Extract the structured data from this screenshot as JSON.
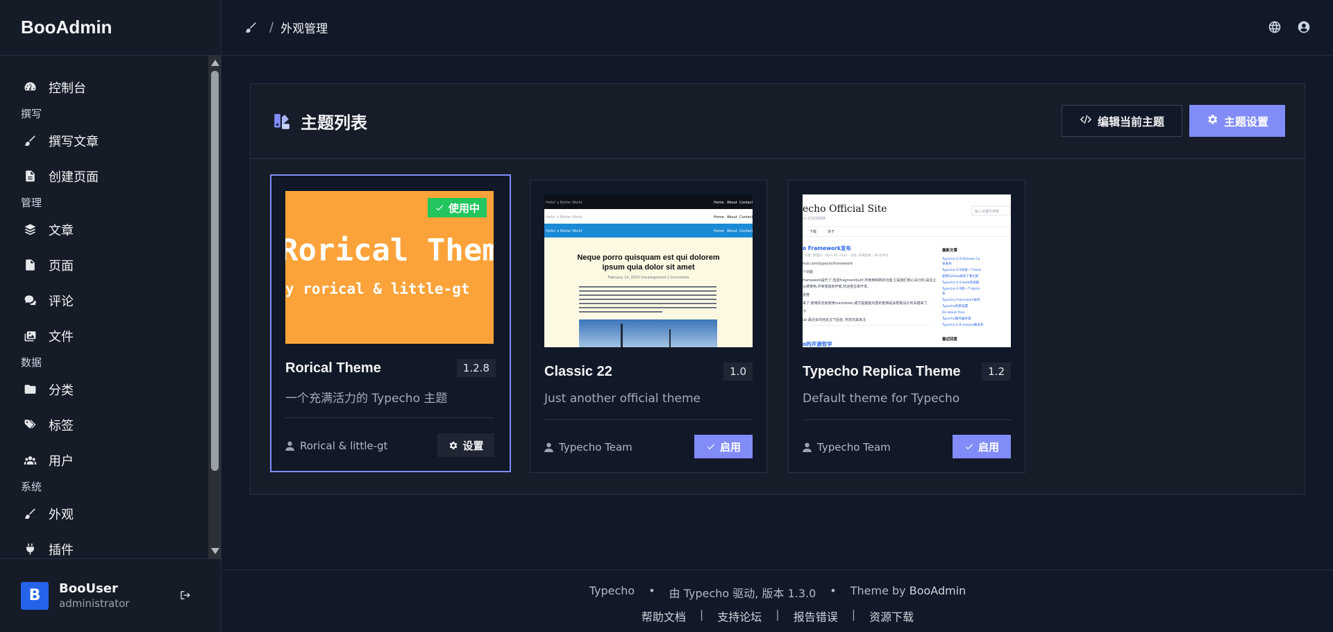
{
  "app": {
    "brand": "BooAdmin"
  },
  "sidebar": {
    "items": [
      {
        "label": "控制台",
        "icon": "dashboard-icon",
        "name": "sidebar-item-dashboard"
      },
      {
        "section": "撰写"
      },
      {
        "label": "撰写文章",
        "icon": "brush-icon",
        "name": "sidebar-item-write-post"
      },
      {
        "label": "创建页面",
        "icon": "file-text-icon",
        "name": "sidebar-item-create-page"
      },
      {
        "section": "管理"
      },
      {
        "label": "文章",
        "icon": "layers-icon",
        "name": "sidebar-item-posts"
      },
      {
        "label": "页面",
        "icon": "file-icon",
        "name": "sidebar-item-pages"
      },
      {
        "label": "评论",
        "icon": "comments-icon",
        "name": "sidebar-item-comments"
      },
      {
        "label": "文件",
        "icon": "images-icon",
        "name": "sidebar-item-files"
      },
      {
        "section": "数据"
      },
      {
        "label": "分类",
        "icon": "folder-icon",
        "name": "sidebar-item-categories"
      },
      {
        "label": "标签",
        "icon": "tags-icon",
        "name": "sidebar-item-tags"
      },
      {
        "label": "用户",
        "icon": "users-icon",
        "name": "sidebar-item-users"
      },
      {
        "section": "系统"
      },
      {
        "label": "外观",
        "icon": "brush-icon",
        "name": "sidebar-item-appearance"
      },
      {
        "label": "插件",
        "icon": "plug-icon",
        "name": "sidebar-item-plugins"
      }
    ]
  },
  "user": {
    "avatar_letter": "B",
    "name": "BooUser",
    "role": "administrator"
  },
  "header": {
    "breadcrumb_sep": "/",
    "breadcrumb_current": "外观管理"
  },
  "panel": {
    "title": "主题列表",
    "edit_button": "编辑当前主题",
    "settings_button": "主题设置"
  },
  "themes": [
    {
      "title": "Rorical Theme",
      "version": "1.2.8",
      "description": "一个充满活力的 Typecho 主题",
      "author": "Rorical & little-gt",
      "active": true,
      "active_badge": "使用中",
      "action": "设置",
      "preview": {
        "big": "Rorical Theme",
        "small": "y rorical & little-gt",
        "bg": "#fba33a"
      }
    },
    {
      "title": "Classic 22",
      "version": "1.0",
      "description": "Just another official theme",
      "author": "Typecho Team",
      "active": false,
      "action": "启用",
      "preview": {
        "site": "Hello! a Better World",
        "nav": [
          "Home",
          "About",
          "Contact"
        ],
        "heading": "Neque porro quisquam est qui dolorem ipsum quia dolor sit amet",
        "meta": "February 14, 2023   Uncategorized   2 Comments",
        "body": "Lorem Ipsum is simply dummy text of the printing and typesetting industry. Lorem Ipsum has been the industry's standard dummy text ever since the 1500s, when an unknown printer took a galley of type and scrambled it to make a type specimen book. It has survived not only five centuries, but also the leap into electronic typesetting, remaining essentially unchanged. It was popularised in the 1960s with the release of Letraset sheets containing Lorem Ipsum passages, and more recently with desktop publishing software like Aldus PageMaker including versions of Lorem Ipsum."
      }
    },
    {
      "title": "Typecho Replica Theme",
      "version": "1.2",
      "description": "Default theme for Typecho",
      "author": "Typecho Team",
      "active": false,
      "action": "启用",
      "preview": {
        "site": "echo Official Site",
        "tagline": "ho 的友情链接",
        "search": "输入关键字搜索",
        "tabs": [
          "下载",
          "关于"
        ],
        "post_title": "o Framework发布",
        "meta": "· 作者: 管理员 · April 16, 2023 · 分类: 开发相关 · 98 条评论",
        "lines": [
          "hub.com/typecho/framework",
          "个功能:",
          "framework提升了,包括fragmentbuilt 所使用和新的功能,它是我们核心设计的,是在让",
          "以被使用,并希望其他作者,欢迎各位来开发。",
          "进度",
          "来了,使用机定就使用markdown,或方提醒能内置的能够是会帮助设计的关键来了。",
          "下:",
          "ub 最近会向他关注下后途, 所定向其来注"
        ],
        "sidebar_title": "最新文章",
        "sidebar_links": [
          "Typecho 0.9 Release Ca",
          "本发布",
          "Typecho 0.9的第一个beta",
          "使用GitHub发布了我们新",
          "Typecho 0.9 beta测试报",
          "Typecho 0.9第一个alpha",
          "布",
          "Typecho Framework发布",
          "Typecho的新设置",
          "Do about Rive",
          "Typecho服务器升级",
          "Typecho 0.8 release版发布"
        ],
        "sidebar_title2": "最近回复",
        "footer_link": "o的开源哲学"
      }
    }
  ],
  "footer": {
    "brand": "Typecho",
    "powered": "由 Typecho 驱动, 版本 1.3.0",
    "theme_by_prefix": "Theme by",
    "theme_by_name": "BooAdmin",
    "links": [
      "帮助文档",
      "支持论坛",
      "报告错误",
      "资源下载"
    ],
    "dot": "•",
    "sep": "|"
  }
}
